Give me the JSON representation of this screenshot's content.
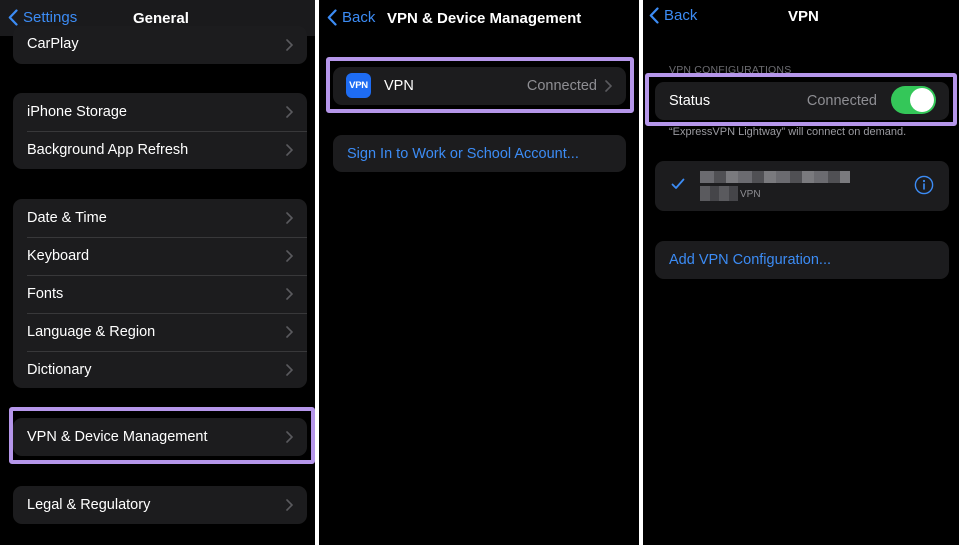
{
  "panel1": {
    "back_label": "Settings",
    "title": "General",
    "group_carplay": [
      "CarPlay"
    ],
    "group_storage": [
      "iPhone Storage",
      "Background App Refresh"
    ],
    "group_datetime": [
      "Date & Time",
      "Keyboard",
      "Fonts",
      "Language & Region",
      "Dictionary"
    ],
    "group_vpn": [
      "VPN & Device Management"
    ],
    "group_legal": [
      "Legal & Regulatory"
    ]
  },
  "panel2": {
    "back_label": "Back",
    "title": "VPN & Device Management",
    "vpn_icon_text": "VPN",
    "vpn_row_label": "VPN",
    "vpn_row_value": "Connected",
    "sign_in_label": "Sign In to Work or School Account..."
  },
  "panel3": {
    "back_label": "Back",
    "title": "VPN",
    "section_header": "VPN CONFIGURATIONS",
    "status_label": "Status",
    "status_value": "Connected",
    "status_on": true,
    "footer_note": "“ExpressVPN Lightway” will connect on demand.",
    "config_sub_label": "VPN",
    "add_config_label": "Add VPN Configuration..."
  },
  "colors": {
    "highlight": "#b596ea",
    "link_blue": "#3c8cf5",
    "toggle_on": "#34c759",
    "group_bg": "#1c1c1e"
  },
  "icons": [
    "chevron-left-icon",
    "chevron-right-icon",
    "vpn-app-icon",
    "checkmark-icon",
    "info-circle-icon"
  ]
}
